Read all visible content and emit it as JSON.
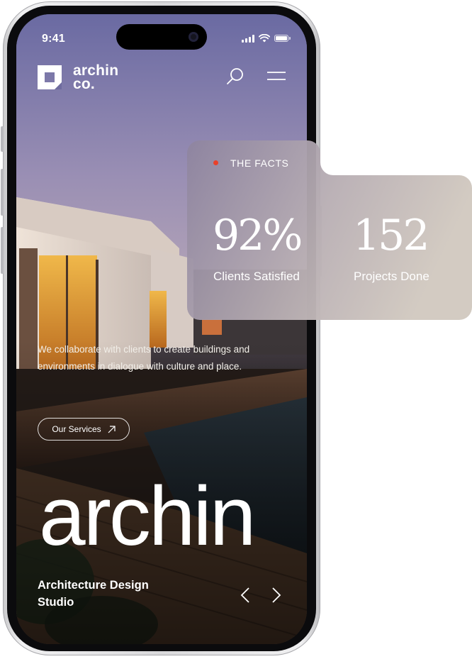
{
  "status_bar": {
    "time": "9:41"
  },
  "header": {
    "logo_text_line1": "archin",
    "logo_text_line2": "co."
  },
  "intro_text": "We collaborate with clients to create buildings and environments in dialogue with culture and place.",
  "services_button": {
    "label": "Our Services"
  },
  "hero": {
    "word": "archin",
    "tagline_line1": "Architecture Design",
    "tagline_line2": "Studio"
  },
  "facts": {
    "label": "THE FACTS",
    "accent_color": "#e9412a",
    "stats": [
      {
        "value": "92%",
        "label": "Clients Satisfied"
      },
      {
        "value": "152",
        "label": "Projects Done"
      }
    ]
  },
  "icons": [
    "logo-icon",
    "search-icon",
    "menu-icon",
    "arrow-up-right-icon",
    "chevron-left-icon",
    "chevron-right-icon"
  ]
}
